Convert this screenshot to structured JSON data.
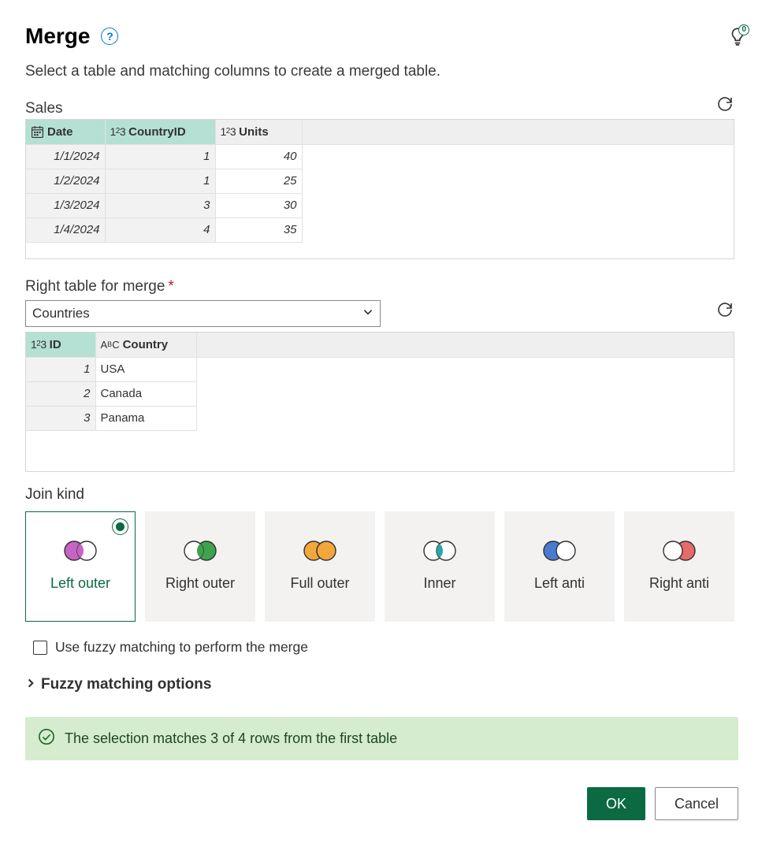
{
  "dialog": {
    "title": "Merge",
    "subtitle": "Select a table and matching columns to create a merged table."
  },
  "tips_badge": "0",
  "left_table": {
    "label": "Sales",
    "columns": [
      {
        "name": "Date",
        "type": "date",
        "selected": true
      },
      {
        "name": "CountryID",
        "type": "number",
        "selected": true
      },
      {
        "name": "Units",
        "type": "number",
        "selected": false
      }
    ],
    "rows": [
      {
        "Date": "1/1/2024",
        "CountryID": "1",
        "Units": "40"
      },
      {
        "Date": "1/2/2024",
        "CountryID": "1",
        "Units": "25"
      },
      {
        "Date": "1/3/2024",
        "CountryID": "3",
        "Units": "30"
      },
      {
        "Date": "1/4/2024",
        "CountryID": "4",
        "Units": "35"
      }
    ]
  },
  "right_section": {
    "label": "Right table for merge",
    "required": "*",
    "selected_table": "Countries"
  },
  "right_table": {
    "columns": [
      {
        "name": "ID",
        "type": "number",
        "selected": true
      },
      {
        "name": "Country",
        "type": "text",
        "selected": false
      }
    ],
    "rows": [
      {
        "ID": "1",
        "Country": "USA"
      },
      {
        "ID": "2",
        "Country": "Canada"
      },
      {
        "ID": "3",
        "Country": "Panama"
      }
    ]
  },
  "join": {
    "label": "Join kind",
    "options": [
      {
        "key": "left-outer",
        "label": "Left outer",
        "selected": true
      },
      {
        "key": "right-outer",
        "label": "Right outer",
        "selected": false
      },
      {
        "key": "full-outer",
        "label": "Full outer",
        "selected": false
      },
      {
        "key": "inner",
        "label": "Inner",
        "selected": false
      },
      {
        "key": "left-anti",
        "label": "Left anti",
        "selected": false
      },
      {
        "key": "right-anti",
        "label": "Right anti",
        "selected": false
      }
    ]
  },
  "fuzzy": {
    "checkbox_label": "Use fuzzy matching to perform the merge",
    "expand_label": "Fuzzy matching options"
  },
  "status": {
    "message": "The selection matches 3 of 4 rows from the first table"
  },
  "buttons": {
    "ok": "OK",
    "cancel": "Cancel"
  },
  "colors": {
    "accent": "#0b6a42",
    "link": "#0078d4",
    "selected_header": "#b5e0d4",
    "status_bg": "#d6ecce"
  }
}
